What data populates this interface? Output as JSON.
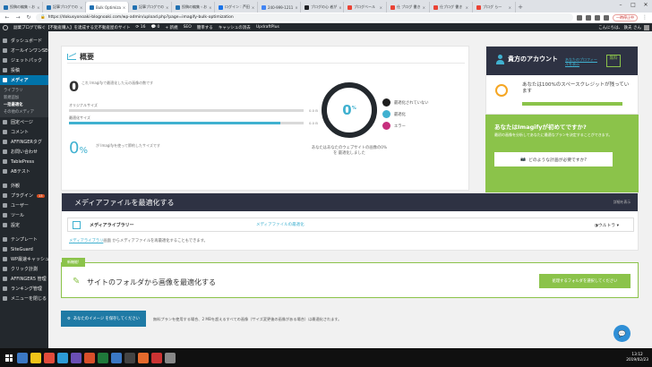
{
  "browser": {
    "tabs": [
      {
        "label": "投稿の編集 ‹ お",
        "color": "#2271b1",
        "active": false
      },
      {
        "label": "記事ブログでの",
        "color": "#2271b1",
        "active": false
      },
      {
        "label": "Bulk Optimiza",
        "color": "#2271b1",
        "active": true
      },
      {
        "label": "記事ブログでの",
        "color": "#2271b1",
        "active": false
      },
      {
        "label": "投稿の編集 ‹ お",
        "color": "#2271b1",
        "active": false
      },
      {
        "label": "ログイン : 芦田",
        "color": "#1a73e8",
        "active": false
      },
      {
        "label": "240-999-1211",
        "color": "#4285f4",
        "active": false
      },
      {
        "label": "ブログの心 者が",
        "color": "#202124",
        "active": false
      },
      {
        "label": "ブログべール",
        "color": "#ea4335",
        "active": false
      },
      {
        "label": "仕 ブログ 書き",
        "color": "#ea4335",
        "active": false
      },
      {
        "label": "仕ブログ 書き",
        "color": "#ea4335",
        "active": false
      },
      {
        "label": "ブログ ら—",
        "color": "#ea4335",
        "active": false
      }
    ],
    "url": "https://dokusyonoaki-blognoaki.com/wp-admin/upload.php?page=imagify-bulk-optimization",
    "profile_chip": "一時停止中"
  },
  "adminbar": {
    "site": "副業ブログで稼ぐ【不動産購入】を達成する元不動産屋のサイト",
    "updates": "16",
    "comments": "0",
    "new": "+ 新規",
    "items": [
      "SEO",
      "簡単する",
      "キャッシュの消去",
      "UpdraftPlus"
    ],
    "greeting": "こんにちは、 鉄夫 さん"
  },
  "sidebar": {
    "items": [
      {
        "label": "ダッシュボード",
        "current": false
      },
      {
        "label": "オールインワンSEO",
        "current": false
      },
      {
        "label": "ジェットパック",
        "current": false
      },
      {
        "label": "投稿",
        "current": false
      },
      {
        "label": "メディア",
        "current": true
      }
    ],
    "submenu": [
      "ライブラリ",
      "新規追加",
      "一括最適化",
      "その他のメディア"
    ],
    "submenu_current": 2,
    "items2": [
      {
        "label": "固定ページ",
        "badge": ""
      },
      {
        "label": "コメント",
        "badge": ""
      },
      {
        "label": "AFFINGERタグ",
        "badge": ""
      },
      {
        "label": "お問い合わせ",
        "badge": ""
      },
      {
        "label": "TablePress",
        "badge": ""
      },
      {
        "label": "ABテスト",
        "badge": ""
      }
    ],
    "items3": [
      {
        "label": "外観",
        "badge": ""
      },
      {
        "label": "プラグイン",
        "badge": "13"
      },
      {
        "label": "ユーザー",
        "badge": ""
      },
      {
        "label": "ツール",
        "badge": ""
      },
      {
        "label": "設定",
        "badge": ""
      }
    ],
    "items4": [
      {
        "label": "テンプレート",
        "badge": ""
      },
      {
        "label": "SiteGuard",
        "badge": ""
      },
      {
        "label": "WP最速キャッシュ",
        "badge": ""
      },
      {
        "label": "クリック計測",
        "badge": ""
      },
      {
        "label": "AFFINGER5 管理",
        "badge": ""
      },
      {
        "label": "ランキング管理",
        "badge": ""
      },
      {
        "label": "メニューを閉じる",
        "badge": ""
      }
    ]
  },
  "overview": {
    "title": "概要",
    "count": "0",
    "count_note": "これ Imagifyで最適化した元の画像の数です",
    "original_label": "オリジナルサイズ",
    "original_val": "0.0 B",
    "optimized_label": "最適化サイズ",
    "optimized_val": "0.0 B",
    "optimized_fill": 0.9,
    "saving_pct": "0",
    "saving_sym": "%",
    "saving_note": "が Imagifyを使って節約したサイズです",
    "ring_val": "0",
    "ring_sym": "%",
    "ring_caption": "あなたはあなたのウェブサイトの画像の0%を 最適化しました",
    "legend": [
      {
        "label": "最適化されていない",
        "color": "#1d1d1d"
      },
      {
        "label": "最適化",
        "color": "#40b1d0"
      },
      {
        "label": "エラー",
        "color": "#c62f7d"
      }
    ]
  },
  "account": {
    "title": "貴方のアカウント",
    "link": "あなたのプロフィールを表示",
    "plan": "無料",
    "quota_text": "あなたは100%のスペースクレジットが残っています",
    "quota_fill": 1.0
  },
  "upsell": {
    "title": "あなたはImagifyが初めてですか?",
    "desc": "最初の画像を分析してあなたに最適なプランを決定することができます。",
    "button": "どのような計画が必要ですか?"
  },
  "media": {
    "title": "メディアファイルを最適化する",
    "help": "詳細を表示",
    "col_library": "メディアライブラリー",
    "col_optimize": "メディアファイルの最適化",
    "col_level": "ウルトラ",
    "note_link": "メディアライブラリ",
    "note_text": "画面 からメディアファイルを再最適化することもできます。"
  },
  "folder": {
    "tag": "新機能!",
    "title": "サイトのフォルダから画像を最適化する",
    "button": "処理するフォルダを選択してください"
  },
  "bulk": {
    "button": "あなたのイメージ を保存してください",
    "note": "無料プランを使用する場合、2 MBを超えるすべての画像（サイズ変更後の画像がある場合）は最適化されます。"
  },
  "taskbar": {
    "time": "13:12",
    "date": "2019/02/23",
    "icons": [
      "#3b78c4",
      "#f0c419",
      "#e24b3b",
      "#2c9bd6",
      "#6a4fb5",
      "#d94f2a",
      "#1f7a3b",
      "#3b78c4",
      "#444444",
      "#e66a2c",
      "#cc3333",
      "#888888"
    ]
  }
}
